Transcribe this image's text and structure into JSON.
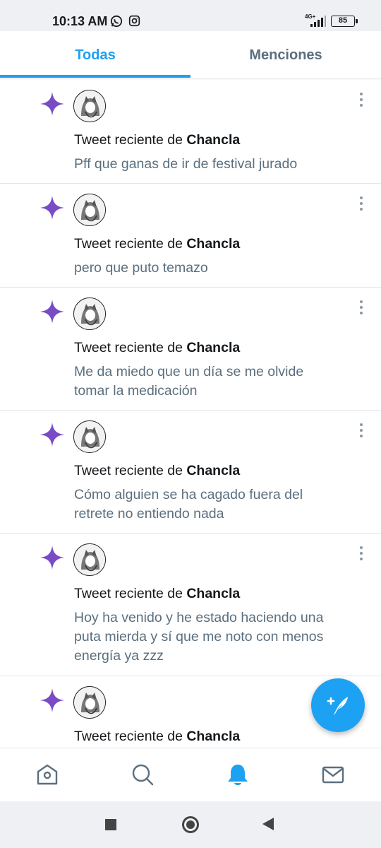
{
  "status_bar": {
    "time": "10:13 AM",
    "network": "4G+",
    "battery": "85",
    "icons": [
      "whatsapp-icon",
      "instagram-icon",
      "signal-icon",
      "battery-icon"
    ]
  },
  "tabs": {
    "all_label": "Todas",
    "mentions_label": "Menciones",
    "active": "Todas"
  },
  "notifications": [
    {
      "prefix": "Tweet reciente de ",
      "author": "Chancla",
      "lines": [
        "Pff que ganas de ir de festival jurado"
      ]
    },
    {
      "prefix": "Tweet reciente de ",
      "author": "Chancla",
      "lines": [
        "pero que puto temazo"
      ]
    },
    {
      "prefix": "Tweet reciente de ",
      "author": "Chancla",
      "lines": [
        "Me da miedo que un día se me olvide",
        "tomar la medicación"
      ]
    },
    {
      "prefix": "Tweet reciente de ",
      "author": "Chancla",
      "lines": [
        "Cómo alguien se ha cagado fuera del",
        "retrete no entiendo nada"
      ]
    },
    {
      "prefix": "Tweet reciente de ",
      "author": "Chancla",
      "lines": [
        "Hoy ha venido y he estado haciendo una",
        "puta mierda y sí que me noto con menos",
        "energía ya zzz"
      ]
    },
    {
      "prefix": "Tweet reciente de ",
      "author": "Chancla",
      "lines": []
    }
  ],
  "colors": {
    "accent": "#1da1f2",
    "sparkle": "#794bc4",
    "secondary_text": "#5b6f7f",
    "primary_text": "#14171a"
  },
  "bottom_nav": [
    "home-icon",
    "search-icon",
    "notifications-icon",
    "messages-icon"
  ],
  "fab": {
    "icon": "compose-tweet-icon"
  }
}
